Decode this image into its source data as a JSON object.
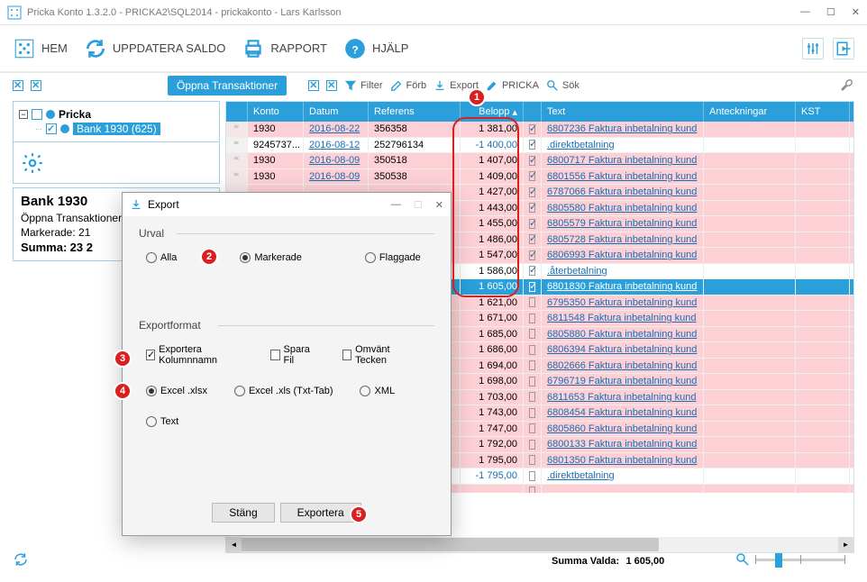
{
  "titlebar": "Pricka Konto 1.3.2.0 - PRICKA2\\SQL2014 - prickakonto - Lars Karlsson",
  "toolbar": {
    "hem": "HEM",
    "uppdatera": "UPPDATERA SALDO",
    "rapport": "RAPPORT",
    "hjalp": "HJÄLP"
  },
  "subbar": {
    "oppna": "Öppna Transaktioner",
    "filter": "Filter",
    "forb": "Förb",
    "export": "Export",
    "pricka": "PRICKA",
    "sok": "Sök"
  },
  "tree": {
    "root": "Pricka",
    "child": "Bank 1930 (625)"
  },
  "info": {
    "title": "Bank 1930",
    "line1": "Öppna Transaktioner",
    "line2": "Markerade: 21",
    "sumlabel": "Summa:",
    "sumval": "23 2"
  },
  "columns": {
    "konto": "Konto",
    "datum": "Datum",
    "referens": "Referens",
    "belopp": "Belopp",
    "text": "Text",
    "ant": "Anteckningar",
    "kst": "KST"
  },
  "rows": [
    {
      "pink": true,
      "flag": "grey",
      "konto": "1930",
      "datum": "2016-08-22",
      "ref": "356358",
      "bel": "1 381,00",
      "chk": true,
      "text": "6807236 Faktura inbetalning kund"
    },
    {
      "pink": false,
      "flag": "grey",
      "konto": "9245737...",
      "datum": "2016-08-12",
      "ref": "252796134",
      "bel": "-1 400,00",
      "neg": true,
      "chk": true,
      "text": ".direktbetalning"
    },
    {
      "pink": true,
      "flag": "grey",
      "konto": "1930",
      "datum": "2016-08-09",
      "ref": "350518",
      "bel": "1 407,00",
      "chk": true,
      "text": "6800717 Faktura inbetalning kund"
    },
    {
      "pink": true,
      "flag": "grey",
      "konto": "1930",
      "datum": "2016-08-09",
      "ref": "350538",
      "bel": "1 409,00",
      "chk": true,
      "text": "6801556 Faktura inbetalning kund"
    },
    {
      "pink": true,
      "bel": "1 427,00",
      "chk": true,
      "text": "6787066 Faktura inbetalning kund"
    },
    {
      "pink": true,
      "bel": "1 443,00",
      "chk": true,
      "text": "6805580 Faktura inbetalning kund"
    },
    {
      "pink": true,
      "bel": "1 455,00",
      "chk": true,
      "text": "6805579 Faktura inbetalning kund"
    },
    {
      "pink": true,
      "bel": "1 486,00",
      "chk": true,
      "text": "6805728 Faktura inbetalning kund"
    },
    {
      "pink": true,
      "bel": "1 547,00",
      "chk": true,
      "text": "6806993 Faktura inbetalning kund"
    },
    {
      "pink": false,
      "bel": "1 586,00",
      "chk": true,
      "text": ".återbetalning"
    },
    {
      "pink": false,
      "sel": true,
      "bel": "1 605,00",
      "chk": true,
      "text": "6801830 Faktura inbetalning kund"
    },
    {
      "pink": true,
      "bel": "1 621,00",
      "chk": false,
      "text": "6795350 Faktura inbetalning kund"
    },
    {
      "pink": true,
      "bel": "1 671,00",
      "chk": false,
      "text": "6811548 Faktura inbetalning kund"
    },
    {
      "pink": true,
      "bel": "1 685,00",
      "chk": false,
      "text": "6805880 Faktura inbetalning kund"
    },
    {
      "pink": true,
      "bel": "1 686,00",
      "chk": false,
      "text": "6806394 Faktura inbetalning kund"
    },
    {
      "pink": true,
      "bel": "1 694,00",
      "chk": false,
      "text": "6802666 Faktura inbetalning kund"
    },
    {
      "pink": true,
      "bel": "1 698,00",
      "chk": false,
      "text": "6796719 Faktura inbetalning kund"
    },
    {
      "pink": true,
      "bel": "1 703,00",
      "chk": false,
      "text": "6811653 Faktura inbetalning kund"
    },
    {
      "pink": true,
      "flag": "blue",
      "bel": "1 743,00",
      "chk": false,
      "text": "6808454 Faktura inbetalning kund"
    },
    {
      "pink": true,
      "bel": "1 747,00",
      "chk": false,
      "text": "6805860 Faktura inbetalning kund"
    },
    {
      "pink": true,
      "bel": "1 792,00",
      "chk": false,
      "text": "6800133 Faktura inbetalning kund"
    },
    {
      "pink": true,
      "bel": "1 795,00",
      "chk": false,
      "text": "6801350 Faktura inbetalning kund"
    },
    {
      "pink": false,
      "bel": "-1 795,00",
      "neg": true,
      "chk": false,
      "text": ".direktbetalning"
    },
    {
      "pink": true,
      "bel": "",
      "chk": false,
      "text": ""
    }
  ],
  "footer": {
    "summa_label": "Summa Valda:",
    "summa_val": "1 605,00"
  },
  "dialog": {
    "title": "Export",
    "urval_label": "Urval",
    "alla": "Alla",
    "markerade": "Markerade",
    "flaggade": "Flaggade",
    "format_label": "Exportformat",
    "kol": "Exportera Kolumnnamn",
    "spara": "Spara Fil",
    "omvant": "Omvänt Tecken",
    "xlsx": "Excel .xlsx",
    "xls": "Excel .xls (Txt-Tab)",
    "xml": "XML",
    "text": "Text",
    "stang": "Stäng",
    "exportera": "Exportera"
  }
}
